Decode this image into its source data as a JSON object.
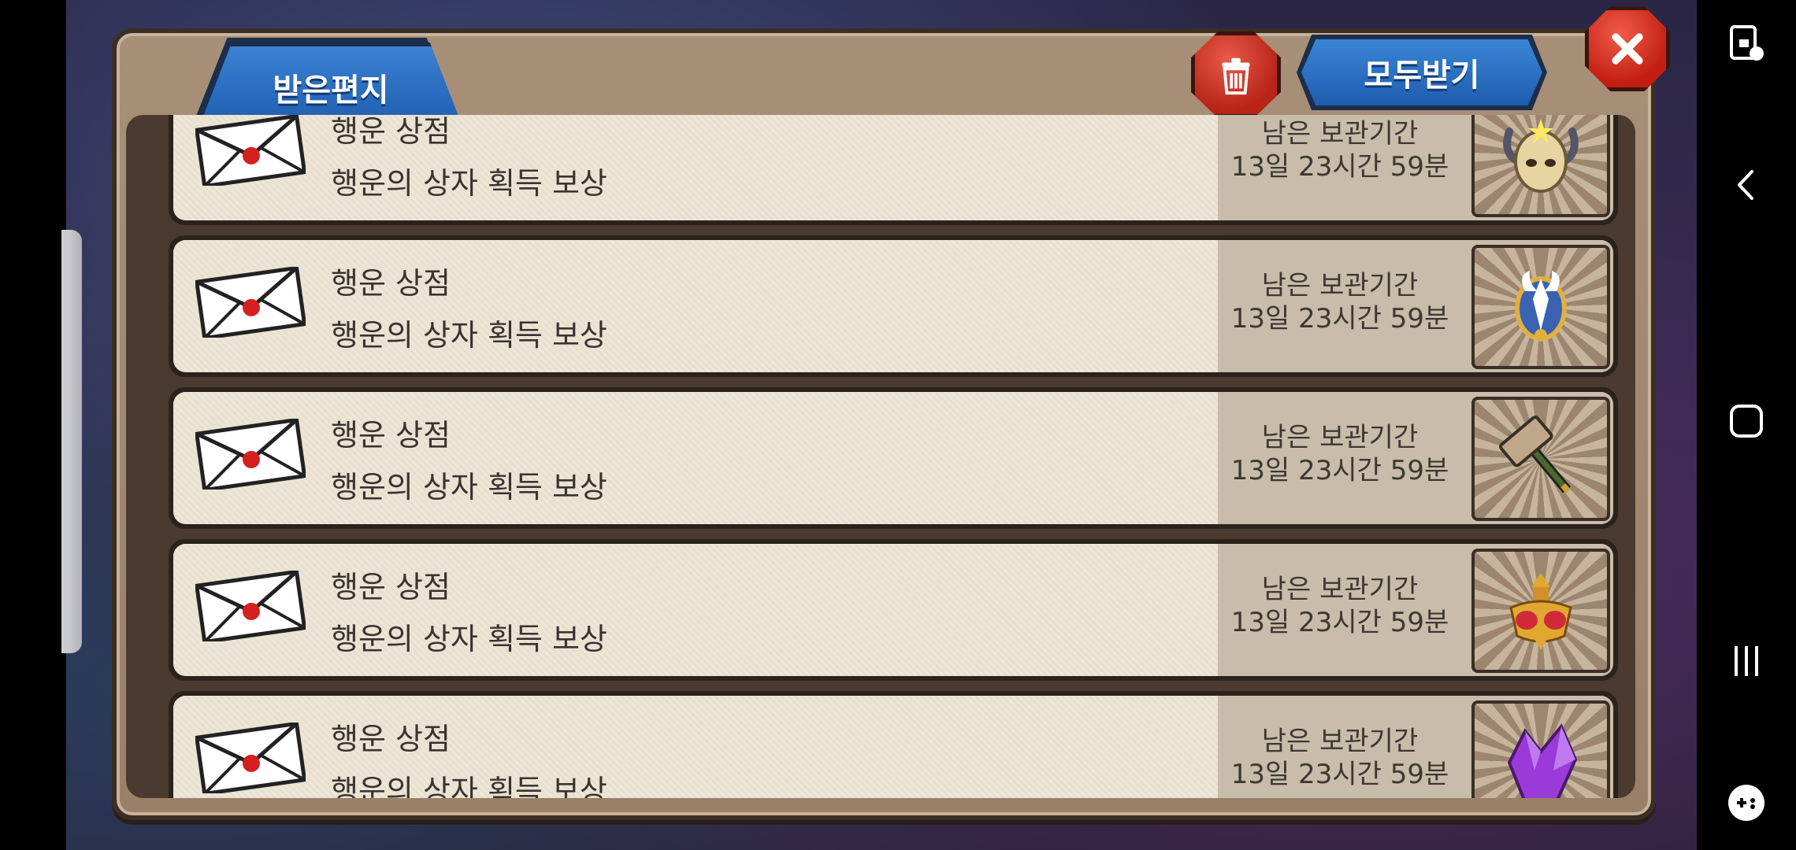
{
  "dialog": {
    "tab_label": "받은편지",
    "receive_all_label": "모두받기"
  },
  "mails": [
    {
      "title": "행운 상점",
      "desc": "행운의 상자 획득 보상",
      "remain_label": "남은 보관기간",
      "remain_time": "13일 23시간 59분",
      "reward_icon": "horned-helmet-icon"
    },
    {
      "title": "행운 상점",
      "desc": "행운의 상자 획득 보상",
      "remain_label": "남은 보관기간",
      "remain_time": "13일 23시간 59분",
      "reward_icon": "winged-emblem-icon"
    },
    {
      "title": "행운 상점",
      "desc": "행운의 상자 획득 보상",
      "remain_label": "남은 보관기간",
      "remain_time": "13일 23시간 59분",
      "reward_icon": "hammer-icon"
    },
    {
      "title": "행운 상점",
      "desc": "행운의 상자 획득 보상",
      "remain_label": "남은 보관기간",
      "remain_time": "13일 23시간 59분",
      "reward_icon": "jeweled-armor-icon"
    },
    {
      "title": "행운 상점",
      "desc": "행운의 상자 획득 보상",
      "remain_label": "남은 보관기간",
      "remain_time": "13일 23시간 59분",
      "reward_icon": "purple-crystal-icon"
    }
  ],
  "navbar": {
    "icons": [
      "screen-lock-icon",
      "back-icon",
      "home-icon",
      "recents-icon",
      "game-tools-icon"
    ]
  },
  "colors": {
    "tab_blue": "#2f74c6",
    "delete_red": "#c8281a",
    "panel_brown": "#a89078"
  }
}
